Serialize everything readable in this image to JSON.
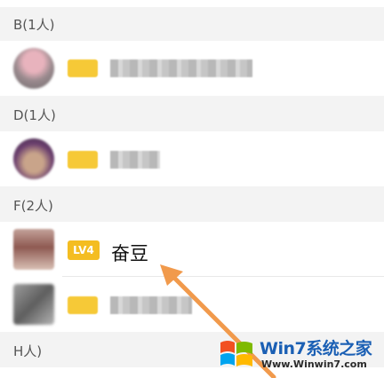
{
  "sections": [
    {
      "header": "B(1人)"
    },
    {
      "header": "D(1人)"
    },
    {
      "header": "F(2人)"
    },
    {
      "header": "H人)"
    }
  ],
  "highlight_contact": {
    "level": "LV4",
    "name": "奋豆"
  },
  "watermark": {
    "brand": "Win7系统之家",
    "url": "Www.Winwin7.com"
  },
  "colors": {
    "badge": "#f4bd21",
    "arrow": "#f19a4c",
    "background": "#f3f3f3"
  }
}
